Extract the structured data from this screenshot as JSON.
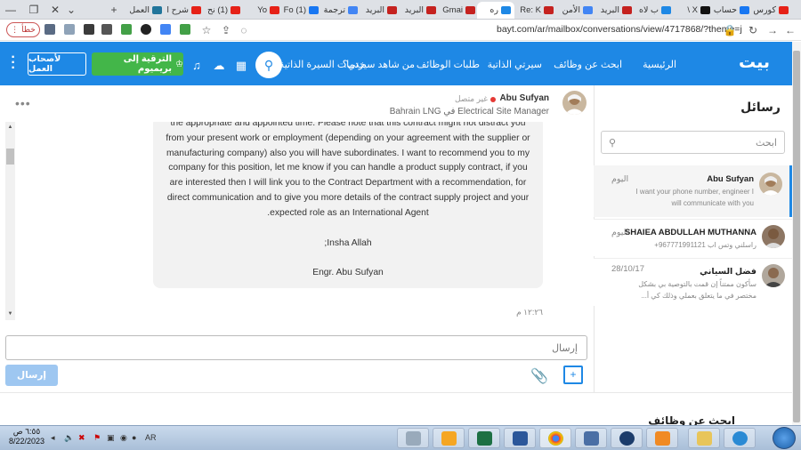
{
  "browser": {
    "tabs": [
      {
        "label": "كورس",
        "color": "#e62117"
      },
      {
        "label": "حساب",
        "color": "#1877f2"
      },
      {
        "label": "X \\",
        "color": "#111111"
      },
      {
        "label": "ب لاه",
        "color": "#1e88e5"
      },
      {
        "label": "البريد",
        "color": "#c5221f"
      },
      {
        "label": "الأمن",
        "color": "#4285f4"
      },
      {
        "label": "Re: K",
        "color": "#c5221f"
      },
      {
        "label": "ره",
        "color": "#1e88e5"
      },
      {
        "label": "Gmai",
        "color": "#c5221f"
      },
      {
        "label": "البريد",
        "color": "#c5221f"
      },
      {
        "label": "البريد",
        "color": "#c5221f"
      },
      {
        "label": "ترجمة",
        "color": "#4285f4"
      },
      {
        "label": "(1) Fo",
        "color": "#1877f2"
      },
      {
        "label": "Yo",
        "color": "#e62117"
      },
      {
        "label": "(1) نح",
        "color": "#e62117"
      },
      {
        "label": "شرح ا",
        "color": "#e62117"
      },
      {
        "label": "العمل",
        "color": "#21759b"
      }
    ],
    "url": "bayt.com/ar/mailbox/conversations/view/4717868/?theme=j",
    "profile_label": "خطأ"
  },
  "nav": {
    "logo": "بيت",
    "links": [
      "الرئيسية",
      "ابحث عن وظائف",
      "سيرتي الذاتية",
      "طلبات الوظائف",
      "من شاهد سيرتي؟",
      "خدمات السيرة الذاتية"
    ],
    "premium_label": "الترقية إلى بريميوم",
    "employers_label": "لأصحاب العمل"
  },
  "sidebar": {
    "title": "رسائل",
    "search_placeholder": "ابحث",
    "conversations": [
      {
        "name": "Abu Sufyan",
        "date": "اليوم",
        "preview": "I want your phone number, engineer I will communicate with you"
      },
      {
        "name": "SHAIEA ABDULLAH MUTHANNA",
        "date": "اليوم",
        "preview": "راسلني وتس اب 967771991121+"
      },
      {
        "name": "فضل السياني",
        "date": "28/10/17",
        "preview": "سأكون ممتناً إن قمت بالتوصية بي بشكل مختصر في ما يتعلق بعملي وذلك كي أ..."
      }
    ]
  },
  "chat": {
    "name": "Abu Sufyan",
    "status": "غير متصل",
    "title": "Electrical Site Manager في Bahrain LNG",
    "message_lines": [
      "the appropriate and appointed time. Please note that this contract might not distract you",
      "from your present work or employment (depending on your agreement with the supplier or",
      "manufacturing company) also you will have subordinates. I want to recommend you to my",
      "company for this position, let me know if you can handle a product supply contract, if you",
      "are interested then I will link you to the Contract Department with a recommendation, for",
      "direct communication and to give you more details of the contract supply project and your",
      "expected role as an International Agent."
    ],
    "closing": "Insha Allah;",
    "signature": "Engr. Abu Sufyan",
    "time": "١٢:٢٦ م",
    "composer_placeholder": "إرسال",
    "send_label": "إرسال"
  },
  "footer": {
    "title": "ابحث عن وظائف"
  },
  "taskbar": {
    "time": "٦:٥٥ ص",
    "date": "8/22/2023",
    "lang": "AR"
  }
}
